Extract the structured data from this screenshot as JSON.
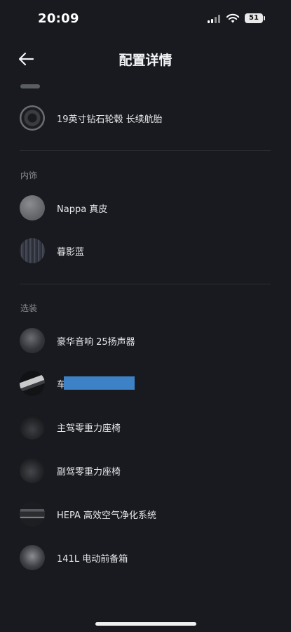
{
  "status_bar": {
    "time": "20:09",
    "battery": "51"
  },
  "header": {
    "title": "配置详情"
  },
  "sections": {
    "wheels": {
      "items": [
        {
          "label": "19英寸钻石轮毂 长续航胎"
        }
      ]
    },
    "interior": {
      "title": "内饰",
      "items": [
        {
          "label": "Nappa 真皮"
        },
        {
          "label": "暮影蓝"
        }
      ]
    },
    "options": {
      "title": "选装",
      "items": [
        {
          "label": "豪华音响 25扬声器"
        },
        {
          "label": "车"
        },
        {
          "label": "主驾零重力座椅"
        },
        {
          "label": "副驾零重力座椅"
        },
        {
          "label": "HEPA 高效空气净化系统"
        },
        {
          "label": "141L 电动前备箱"
        }
      ]
    }
  },
  "colors": {
    "background": "#181a1f",
    "redaction": "#3d82c7"
  }
}
